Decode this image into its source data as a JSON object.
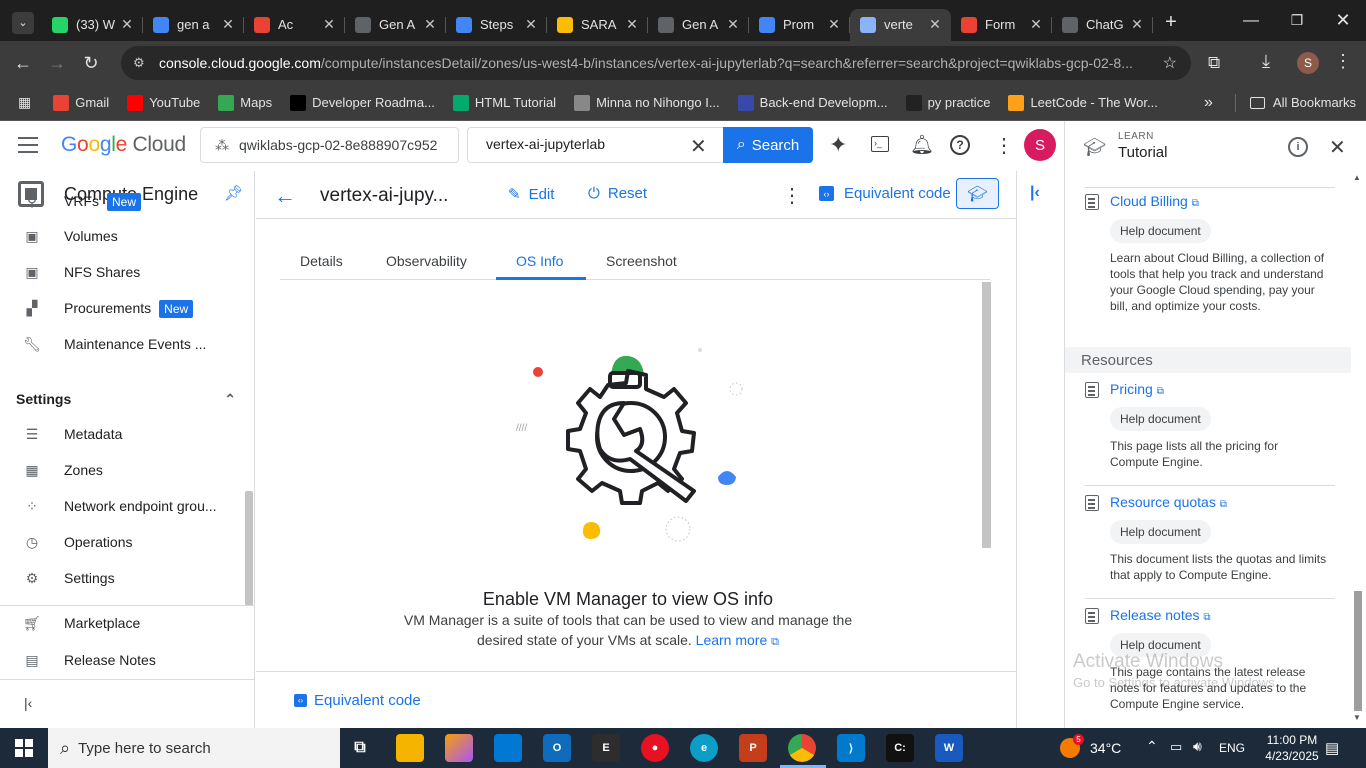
{
  "browser": {
    "tabs": [
      {
        "title": "(33) W",
        "icon": "whatsapp-icon",
        "color": "#25d366",
        "badge": "33"
      },
      {
        "title": "gen a",
        "icon": "google-icon",
        "color": "#4285f4"
      },
      {
        "title": "Ac",
        "icon": "gmail-icon",
        "color": "#ea4335"
      },
      {
        "title": "Gen A",
        "icon": "doc-icon",
        "color": "#5f6368"
      },
      {
        "title": "Steps",
        "icon": "docs-icon",
        "color": "#4285f4"
      },
      {
        "title": "SARA",
        "icon": "drive-icon",
        "color": "#fbbc04"
      },
      {
        "title": "Gen A",
        "icon": "doc-icon",
        "color": "#5f6368"
      },
      {
        "title": "Prom",
        "icon": "cloud-icon",
        "color": "#4285f4"
      },
      {
        "title": "verte",
        "icon": "compute-icon",
        "color": "#8ab4f8"
      },
      {
        "title": "Form",
        "icon": "gmail-icon",
        "color": "#ea4335"
      },
      {
        "title": "ChatG",
        "icon": "chatgpt-icon",
        "color": "#5f6368"
      }
    ],
    "url_host": "console.cloud.google.com",
    "url_path": "/compute/instancesDetail/zones/us-west4-b/instances/vertex-ai-jupyterlab?q=search&referrer=search&project=qwiklabs-gcp-02-8...",
    "profile_initial": "S",
    "bookmarks": [
      {
        "label": "Gmail",
        "icon": "gmail-icon",
        "color": "#ea4335"
      },
      {
        "label": "YouTube",
        "icon": "youtube-icon",
        "color": "#ff0000"
      },
      {
        "label": "Maps",
        "icon": "maps-icon",
        "color": "#34a853"
      },
      {
        "label": "Developer Roadma...",
        "icon": "roadmap-icon",
        "color": "#000000"
      },
      {
        "label": "HTML Tutorial",
        "icon": "w3-icon",
        "color": "#04aa6d"
      },
      {
        "label": "Minna no Nihongo I...",
        "icon": "bookmark-icon",
        "color": "#888888"
      },
      {
        "label": "Back-end Developm...",
        "icon": "coursera-icon",
        "color": "#3949ab"
      },
      {
        "label": "py practice",
        "icon": "cc-icon",
        "color": "#222222"
      },
      {
        "label": "LeetCode - The Wor...",
        "icon": "leetcode-icon",
        "color": "#ffa116"
      }
    ],
    "all_bookmarks": "All Bookmarks"
  },
  "gcp": {
    "brand": "Google Cloud",
    "project": "qwiklabs-gcp-02-8e888907c952",
    "search_value": "vertex-ai-jupyterlab",
    "search_button": "Search",
    "avatar": "S"
  },
  "sidebar": {
    "product": "Compute Engine",
    "items": [
      {
        "label": "VRFs",
        "icon": "network-icon",
        "badge": "New"
      },
      {
        "label": "Volumes",
        "icon": "disk-icon"
      },
      {
        "label": "NFS Shares",
        "icon": "disk-icon"
      },
      {
        "label": "Procurements",
        "icon": "grid-icon",
        "badge": "New"
      },
      {
        "label": "Maintenance Events ...",
        "icon": "wrench-icon"
      }
    ],
    "settings_section": "Settings",
    "settings_items": [
      {
        "label": "Metadata",
        "icon": "list-icon"
      },
      {
        "label": "Zones",
        "icon": "zones-icon"
      },
      {
        "label": "Network endpoint grou...",
        "icon": "endpoint-icon"
      },
      {
        "label": "Operations",
        "icon": "clock-icon"
      },
      {
        "label": "Settings",
        "icon": "gear-icon"
      }
    ],
    "marketplace": "Marketplace",
    "release_notes": "Release Notes"
  },
  "instance": {
    "name": "vertex-ai-jupy...",
    "edit": "Edit",
    "reset": "Reset",
    "equivalent_code": "Equivalent code",
    "tabs": [
      "Details",
      "Observability",
      "OS Info",
      "Screenshot"
    ],
    "active_tab": "OS Info",
    "empty_title": "Enable VM Manager to view OS info",
    "empty_desc_1": "VM Manager is a suite of tools that can be used to view and manage the",
    "empty_desc_2": "desired state of your VMs at scale.",
    "learn_more": "Learn more",
    "footer_code": "Equivalent code"
  },
  "tutorial": {
    "label": "LEARN",
    "title": "Tutorial",
    "items": [
      {
        "title": "Cloud Billing",
        "chip": "Help document",
        "desc": "Learn about Cloud Billing, a collection of tools that help you track and understand your Google Cloud spending, pay your bill, and optimize your costs."
      }
    ],
    "resources_header": "Resources",
    "resources": [
      {
        "title": "Pricing",
        "chip": "Help document",
        "desc": "This page lists all the pricing for Compute Engine."
      },
      {
        "title": "Resource quotas",
        "chip": "Help document",
        "desc": "This document lists the quotas and limits that apply to Compute Engine."
      },
      {
        "title": "Release notes",
        "chip": "Help document",
        "desc": "This page contains the latest release notes for features and updates to the Compute Engine service."
      }
    ]
  },
  "watermark": {
    "line1": "Activate Windows",
    "line2": "Go to Settings to activate Windows."
  },
  "taskbar": {
    "search_placeholder": "Type here to search",
    "weather": "34°C",
    "lang": "ENG",
    "time": "11:00 PM",
    "date": "4/23/2025",
    "notification_count": "5"
  }
}
